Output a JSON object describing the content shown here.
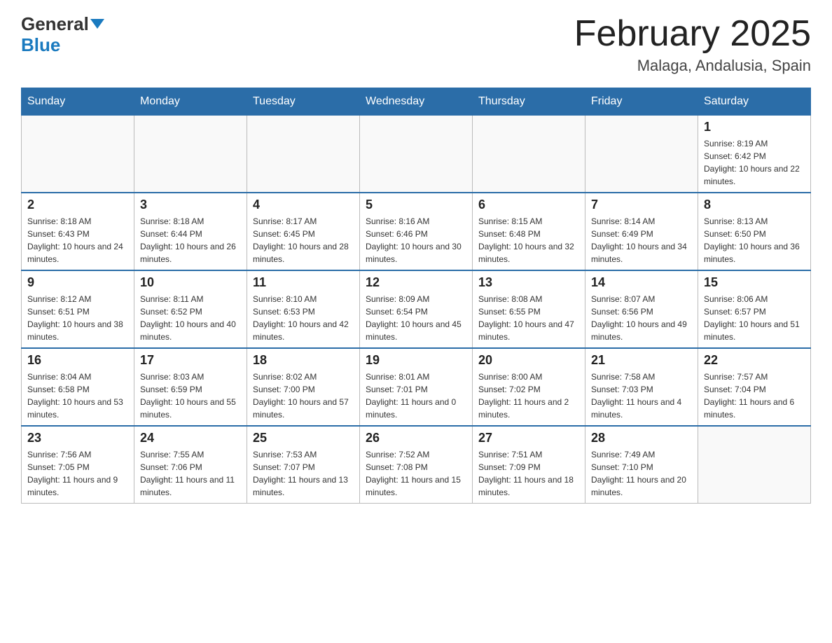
{
  "logo": {
    "text_general": "General",
    "text_blue": "Blue"
  },
  "header": {
    "title": "February 2025",
    "subtitle": "Malaga, Andalusia, Spain"
  },
  "weekdays": [
    "Sunday",
    "Monday",
    "Tuesday",
    "Wednesday",
    "Thursday",
    "Friday",
    "Saturday"
  ],
  "weeks": [
    [
      {
        "day": "",
        "info": ""
      },
      {
        "day": "",
        "info": ""
      },
      {
        "day": "",
        "info": ""
      },
      {
        "day": "",
        "info": ""
      },
      {
        "day": "",
        "info": ""
      },
      {
        "day": "",
        "info": ""
      },
      {
        "day": "1",
        "info": "Sunrise: 8:19 AM\nSunset: 6:42 PM\nDaylight: 10 hours and 22 minutes."
      }
    ],
    [
      {
        "day": "2",
        "info": "Sunrise: 8:18 AM\nSunset: 6:43 PM\nDaylight: 10 hours and 24 minutes."
      },
      {
        "day": "3",
        "info": "Sunrise: 8:18 AM\nSunset: 6:44 PM\nDaylight: 10 hours and 26 minutes."
      },
      {
        "day": "4",
        "info": "Sunrise: 8:17 AM\nSunset: 6:45 PM\nDaylight: 10 hours and 28 minutes."
      },
      {
        "day": "5",
        "info": "Sunrise: 8:16 AM\nSunset: 6:46 PM\nDaylight: 10 hours and 30 minutes."
      },
      {
        "day": "6",
        "info": "Sunrise: 8:15 AM\nSunset: 6:48 PM\nDaylight: 10 hours and 32 minutes."
      },
      {
        "day": "7",
        "info": "Sunrise: 8:14 AM\nSunset: 6:49 PM\nDaylight: 10 hours and 34 minutes."
      },
      {
        "day": "8",
        "info": "Sunrise: 8:13 AM\nSunset: 6:50 PM\nDaylight: 10 hours and 36 minutes."
      }
    ],
    [
      {
        "day": "9",
        "info": "Sunrise: 8:12 AM\nSunset: 6:51 PM\nDaylight: 10 hours and 38 minutes."
      },
      {
        "day": "10",
        "info": "Sunrise: 8:11 AM\nSunset: 6:52 PM\nDaylight: 10 hours and 40 minutes."
      },
      {
        "day": "11",
        "info": "Sunrise: 8:10 AM\nSunset: 6:53 PM\nDaylight: 10 hours and 42 minutes."
      },
      {
        "day": "12",
        "info": "Sunrise: 8:09 AM\nSunset: 6:54 PM\nDaylight: 10 hours and 45 minutes."
      },
      {
        "day": "13",
        "info": "Sunrise: 8:08 AM\nSunset: 6:55 PM\nDaylight: 10 hours and 47 minutes."
      },
      {
        "day": "14",
        "info": "Sunrise: 8:07 AM\nSunset: 6:56 PM\nDaylight: 10 hours and 49 minutes."
      },
      {
        "day": "15",
        "info": "Sunrise: 8:06 AM\nSunset: 6:57 PM\nDaylight: 10 hours and 51 minutes."
      }
    ],
    [
      {
        "day": "16",
        "info": "Sunrise: 8:04 AM\nSunset: 6:58 PM\nDaylight: 10 hours and 53 minutes."
      },
      {
        "day": "17",
        "info": "Sunrise: 8:03 AM\nSunset: 6:59 PM\nDaylight: 10 hours and 55 minutes."
      },
      {
        "day": "18",
        "info": "Sunrise: 8:02 AM\nSunset: 7:00 PM\nDaylight: 10 hours and 57 minutes."
      },
      {
        "day": "19",
        "info": "Sunrise: 8:01 AM\nSunset: 7:01 PM\nDaylight: 11 hours and 0 minutes."
      },
      {
        "day": "20",
        "info": "Sunrise: 8:00 AM\nSunset: 7:02 PM\nDaylight: 11 hours and 2 minutes."
      },
      {
        "day": "21",
        "info": "Sunrise: 7:58 AM\nSunset: 7:03 PM\nDaylight: 11 hours and 4 minutes."
      },
      {
        "day": "22",
        "info": "Sunrise: 7:57 AM\nSunset: 7:04 PM\nDaylight: 11 hours and 6 minutes."
      }
    ],
    [
      {
        "day": "23",
        "info": "Sunrise: 7:56 AM\nSunset: 7:05 PM\nDaylight: 11 hours and 9 minutes."
      },
      {
        "day": "24",
        "info": "Sunrise: 7:55 AM\nSunset: 7:06 PM\nDaylight: 11 hours and 11 minutes."
      },
      {
        "day": "25",
        "info": "Sunrise: 7:53 AM\nSunset: 7:07 PM\nDaylight: 11 hours and 13 minutes."
      },
      {
        "day": "26",
        "info": "Sunrise: 7:52 AM\nSunset: 7:08 PM\nDaylight: 11 hours and 15 minutes."
      },
      {
        "day": "27",
        "info": "Sunrise: 7:51 AM\nSunset: 7:09 PM\nDaylight: 11 hours and 18 minutes."
      },
      {
        "day": "28",
        "info": "Sunrise: 7:49 AM\nSunset: 7:10 PM\nDaylight: 11 hours and 20 minutes."
      },
      {
        "day": "",
        "info": ""
      }
    ]
  ]
}
